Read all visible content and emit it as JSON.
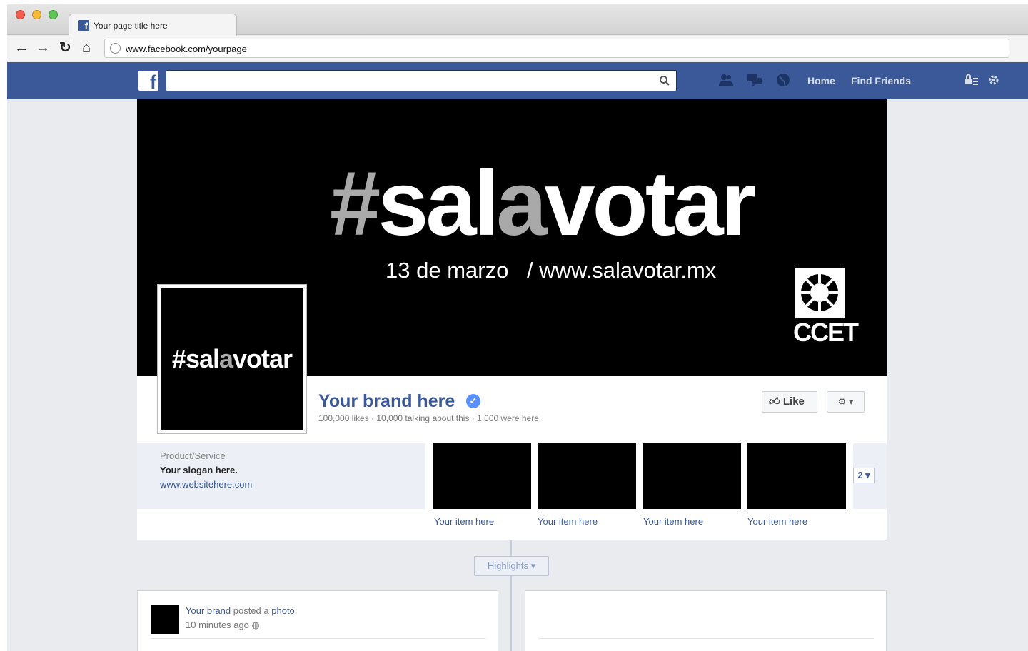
{
  "browser": {
    "tab_title": "Your page title here",
    "tab_icon": "facebook-icon",
    "url": "www.facebook.com/yourpage",
    "nav_icons": [
      "back-arrow-icon",
      "forward-arrow-icon",
      "reload-icon",
      "home-icon"
    ]
  },
  "fb_bar": {
    "logo": "f",
    "search_placeholder": "",
    "icons": [
      "friend-requests-icon",
      "messages-icon",
      "notifications-globe-icon"
    ],
    "home_label": "Home",
    "find_friends_label": "Find Friends",
    "right_icons": [
      "privacy-shortcuts-icon",
      "settings-gear-icon"
    ],
    "color": "#3b5998"
  },
  "cover": {
    "hash": "#",
    "sal": "sal",
    "a": "a",
    "votar": "votar",
    "date": "13 de marzo",
    "url": "/ www.salavotar.mx",
    "org_logo_text": "CCET"
  },
  "profile": {
    "avatar_hash": "#",
    "avatar_sal": "sal",
    "avatar_a": "a",
    "avatar_votar": "votar",
    "name": "Your brand here",
    "verified_icon": "verified-check-icon",
    "stats": "100,000 likes · 10,000 talking about this · 1,000 were here",
    "like_label": "Like",
    "settings_label": "⚙ ▾"
  },
  "about": {
    "category": "Product/Service",
    "slogan": "Your slogan here.",
    "website": "www.websitehere.com"
  },
  "items": [
    {
      "label": "Your item here"
    },
    {
      "label": "Your item here"
    },
    {
      "label": "Your item here"
    },
    {
      "label": "Your item here"
    }
  ],
  "more_button": "2 ▾",
  "timeline": {
    "highlights_label": "Highlights ▾"
  },
  "post": {
    "author": "Your brand",
    "action": " posted a ",
    "object": "photo.",
    "time": "10 minutes ago"
  }
}
